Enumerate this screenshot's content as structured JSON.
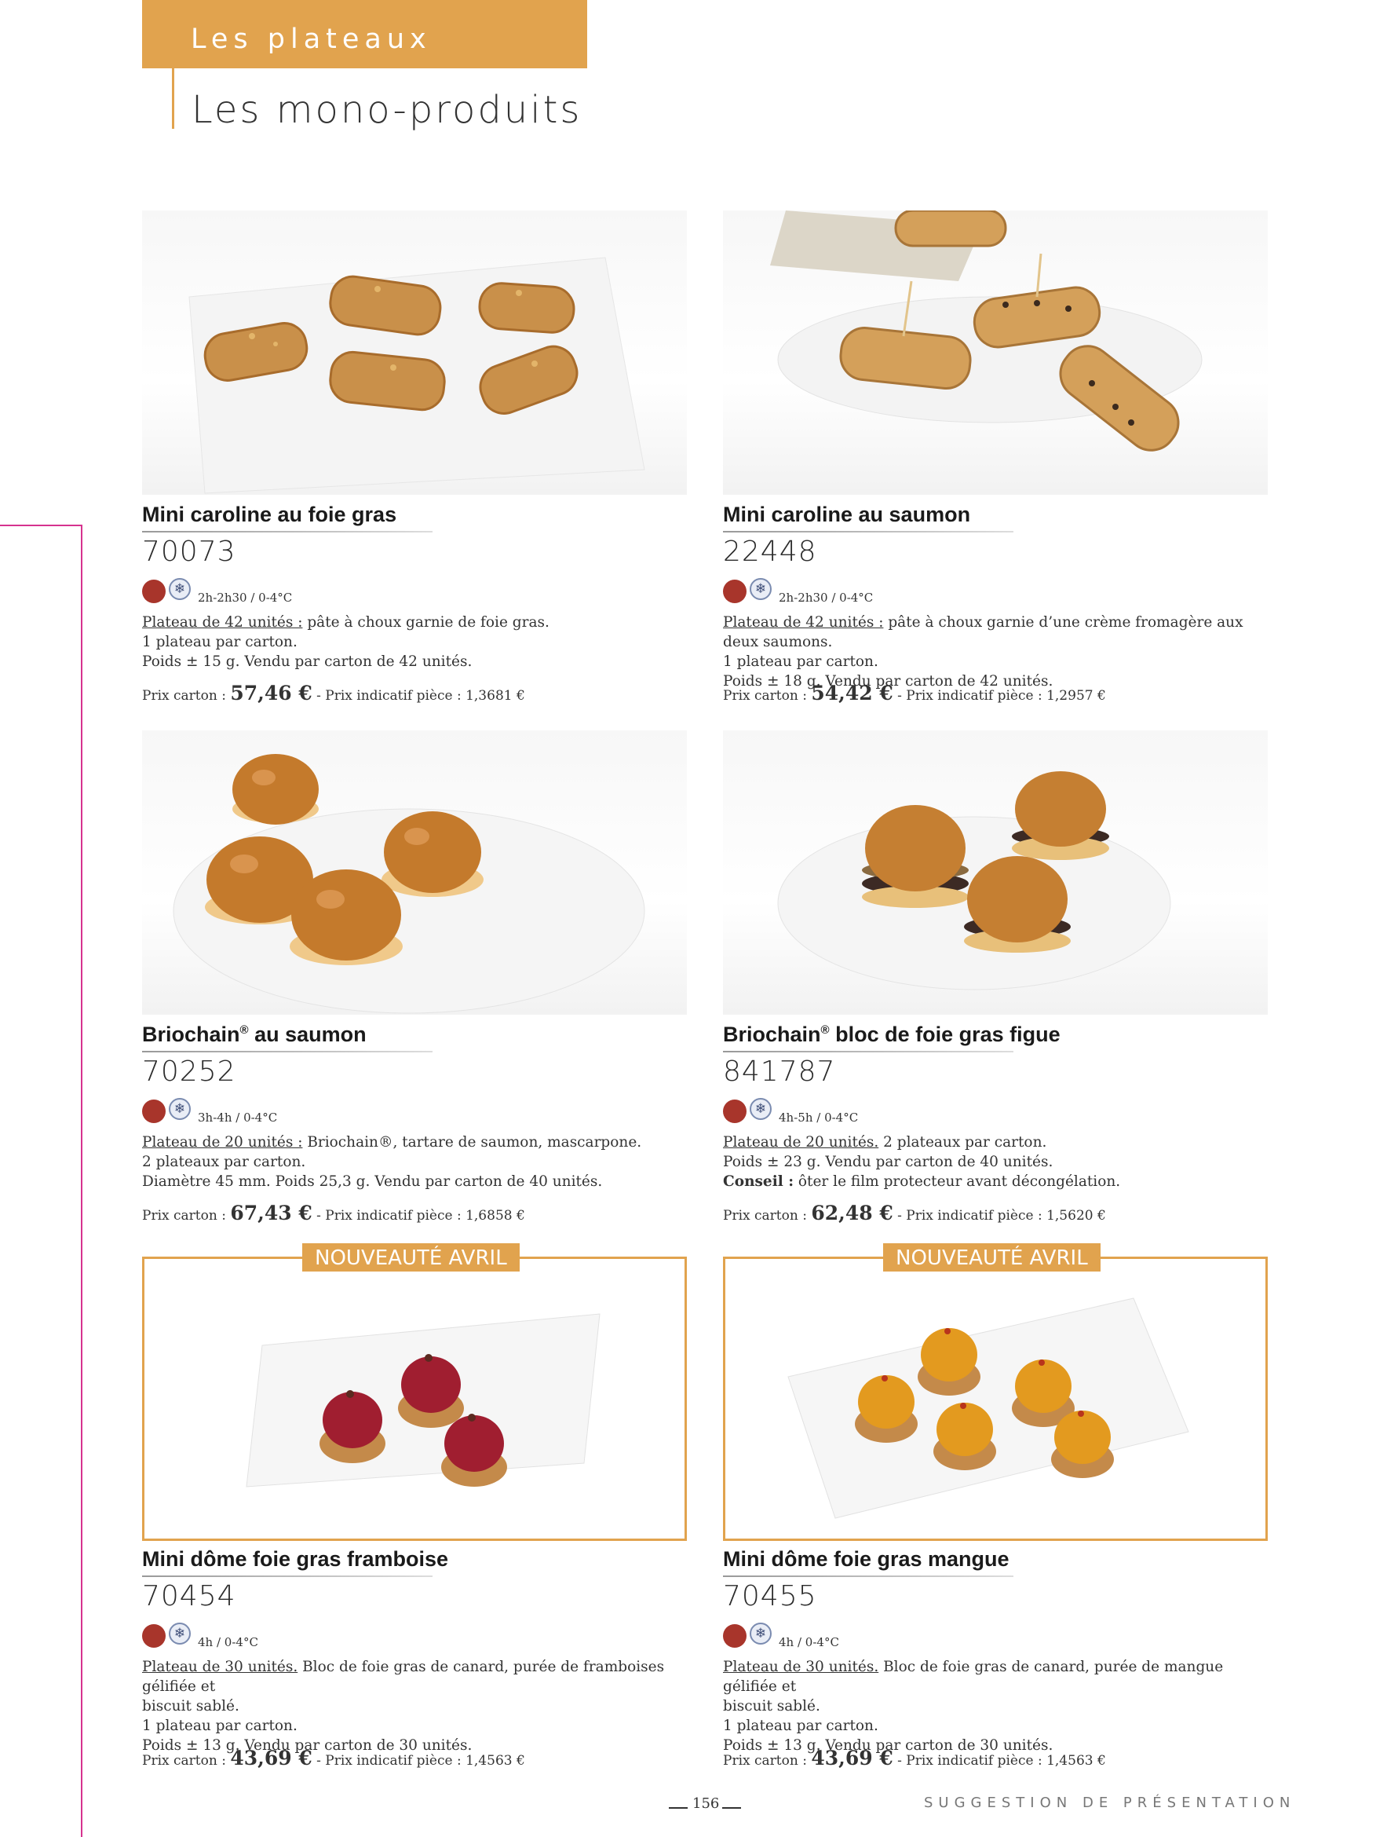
{
  "header": {
    "section": "Les plateaux",
    "title": "Les mono-produits"
  },
  "products": [
    {
      "name": "Mini caroline au foie gras",
      "code": "70073",
      "thaw": "2h-2h30 / 0-4°C",
      "plateau": "Plateau de 42 unités :",
      "composition": " pâte à choux garnie de foie gras.",
      "line2": "1 plateau par carton.",
      "line3": "Poids ± 15 g. Vendu par carton de 42 unités.",
      "price_label": "Prix carton : ",
      "price": "57,46 €",
      "price_unit": " - Prix indicatif pièce : 1,3681 €"
    },
    {
      "name": "Mini caroline au saumon",
      "code": "22448",
      "thaw": "2h-2h30 / 0-4°C",
      "plateau": "Plateau de 42 unités :",
      "composition": " pâte à choux garnie d’une crème fromagère aux deux saumons.",
      "line2": "1 plateau par carton.",
      "line3": "Poids ± 18 g. Vendu par carton de 42 unités.",
      "price_label": "Prix carton : ",
      "price": "54,42 €",
      "price_unit": " - Prix indicatif pièce : 1,2957 €"
    },
    {
      "name": "Briochain",
      "name_reg": "®",
      "name_rest": " au saumon",
      "code": "70252",
      "thaw": "3h-4h / 0-4°C",
      "plateau": "Plateau de 20 unités :",
      "composition": " Briochain®, tartare de saumon, mascarpone.",
      "line2": "2 plateaux par carton.",
      "line3": "Diamètre 45 mm.  Poids 25,3 g. Vendu par carton de 40 unités.",
      "price_label": "Prix carton : ",
      "price": "67,43 €",
      "price_unit": " - Prix indicatif pièce : 1,6858 €"
    },
    {
      "name": "Briochain",
      "name_reg": "®",
      "name_rest": " bloc de foie gras figue",
      "code": "841787",
      "thaw": "4h-5h / 0-4°C",
      "plateau": "Plateau de 20 unités.",
      "composition": " 2 plateaux par carton.",
      "line2": "Poids ± 23 g. Vendu par carton de 40 unités.",
      "advice_label": "Conseil :",
      "advice": " ôter le film protecteur avant décongélation.",
      "price_label": "Prix carton : ",
      "price": "62,48 €",
      "price_unit": " - Prix indicatif pièce : 1,5620 €"
    },
    {
      "badge": "NOUVEAUTÉ AVRIL",
      "name": "Mini dôme foie gras framboise",
      "code": "70454",
      "thaw": "4h / 0-4°C",
      "plateau": "Plateau de 30 unités.",
      "composition": " Bloc de foie gras de canard, purée de framboises gélifiée et",
      "line1b": "biscuit sablé.",
      "line2": "1 plateau par carton.",
      "line3": "Poids ± 13 g. Vendu par carton de 30 unités.",
      "price_label": "Prix carton : ",
      "price": "43,69 €",
      "price_unit": " - Prix indicatif pièce : 1,4563 €"
    },
    {
      "badge": "NOUVEAUTÉ AVRIL",
      "name": "Mini dôme foie gras mangue",
      "code": "70455",
      "thaw": "4h / 0-4°C",
      "plateau": "Plateau de 30 unités.",
      "composition": " Bloc de foie gras de canard, purée de mangue gélifiée et",
      "line1b": "biscuit sablé.",
      "line2": "1 plateau par carton.",
      "line3": "Poids ± 13 g. Vendu par carton de 30 unités.",
      "price_label": "Prix carton : ",
      "price": "43,69 €",
      "price_unit": " - Prix indicatif pièce : 1,4563 €"
    }
  ],
  "footer": {
    "page": "156",
    "note": "SUGGESTION DE PRÉSENTATION"
  },
  "colors": {
    "accent": "#e1a34e",
    "side_rule": "#d6338f",
    "dot": "#a8352b"
  }
}
